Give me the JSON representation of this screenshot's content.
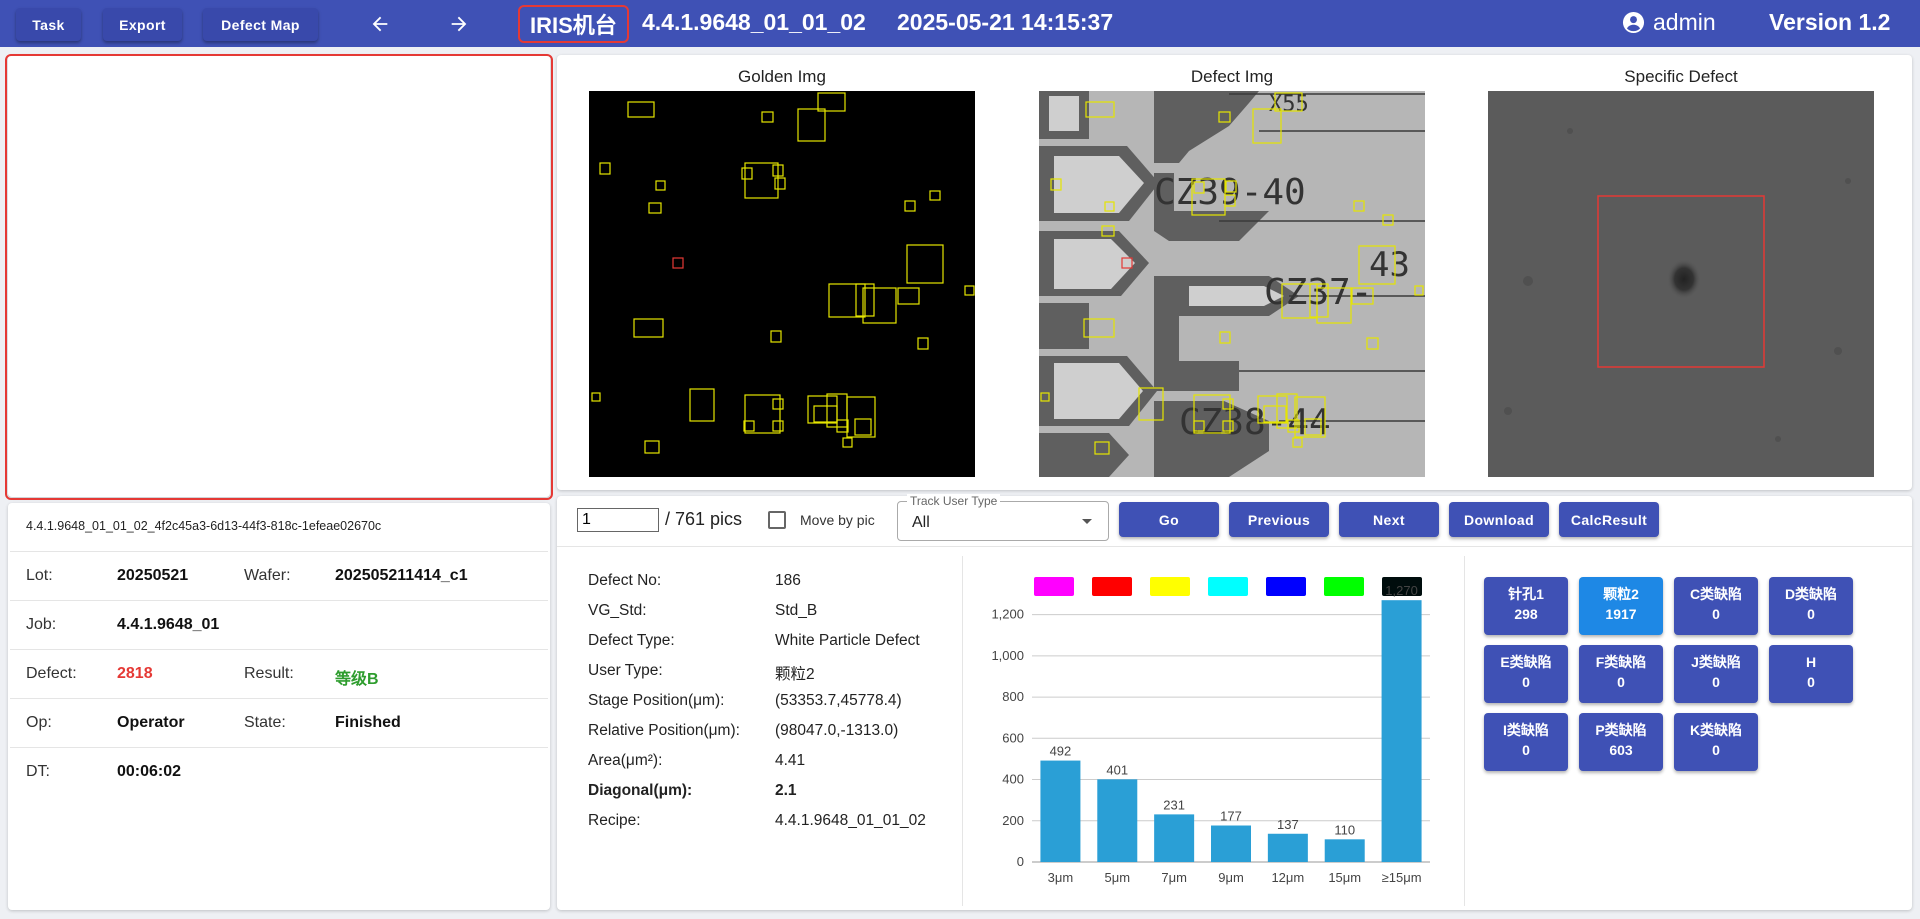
{
  "toolbar": {
    "task_label": "Task",
    "export_label": "Export",
    "defect_map_label": "Defect Map",
    "machine_label": "IRIS机台",
    "recipe_title": "4.4.1.9648_01_01_02",
    "datetime": "2025-05-21 14:15:37",
    "user_name": "admin",
    "version": "Version 1.2"
  },
  "images": {
    "golden_title": "Golden Img",
    "defect_title": "Defect Img",
    "specific_title": "Specific Defect",
    "defect_labels": {
      "row1": "CZ39-40",
      "row2": "CZ37-",
      "row3": "CZ38-44",
      "badge": "43",
      "top": "X55"
    }
  },
  "left_info": {
    "uuid": "4.4.1.9648_01_01_02_4f2c45a3-6d13-44f3-818c-1efeae02670c",
    "lot_label": "Lot:",
    "lot_value": "20250521",
    "wafer_label": "Wafer:",
    "wafer_value": "202505211414_c1",
    "job_label": "Job:",
    "job_value": "4.4.1.9648_01",
    "defect_label": "Defect:",
    "defect_value": "2818",
    "result_label": "Result:",
    "result_value": "等级B",
    "op_label": "Op:",
    "op_value": "Operator",
    "state_label": "State:",
    "state_value": "Finished",
    "dt_label": "DT:",
    "dt_value": "00:06:02"
  },
  "controls": {
    "page_value": "1",
    "page_total": "/ 761 pics",
    "move_by_pic_label": "Move by pic",
    "track_user_type_label": "Track User Type",
    "track_user_type_value": "All",
    "go_label": "Go",
    "previous_label": "Previous",
    "next_label": "Next",
    "download_label": "Download",
    "calc_result_label": "CalcResult"
  },
  "defect_detail": {
    "defect_no_label": "Defect No:",
    "defect_no_value": "186",
    "vg_std_label": "VG_Std:",
    "vg_std_value": "Std_B",
    "defect_type_label": "Defect Type:",
    "defect_type_value": "White Particle Defect",
    "user_type_label": "User Type:",
    "user_type_value": "颗粒2",
    "stage_pos_label": "Stage Position(μm):",
    "stage_pos_value": "(53353.7,45778.4)",
    "rel_pos_label": "Relative Position(μm):",
    "rel_pos_value": "(98047.0,-1313.0)",
    "area_label": "Area(μm²):",
    "area_value": "4.41",
    "diagonal_label": "Diagonal(μm):",
    "diagonal_value": "2.1",
    "recipe_label": "Recipe:",
    "recipe_value": "4.4.1.9648_01_01_02"
  },
  "legend_colors": [
    "#ff00ff",
    "#ff0000",
    "#ffff00",
    "#00ffff",
    "#0000ff",
    "#00ff00",
    "#000d0d"
  ],
  "chart_data": {
    "type": "bar",
    "categories": [
      "3μm",
      "5μm",
      "7μm",
      "9μm",
      "12μm",
      "15μm",
      "≥15μm"
    ],
    "values": [
      492,
      401,
      231,
      177,
      137,
      110,
      1270
    ],
    "ylim": [
      0,
      1300
    ],
    "yticks": [
      "0",
      "200",
      "400",
      "600",
      "800",
      "1,000",
      "1,200"
    ],
    "value_labels": [
      "492",
      "401",
      "231",
      "177",
      "137",
      "110",
      "1,270"
    ],
    "bar_color": "#2a9fd6",
    "grid": true
  },
  "categories_tiles": [
    {
      "name": "针孔1",
      "count": "298",
      "active": false
    },
    {
      "name": "颗粒2",
      "count": "1917",
      "active": true
    },
    {
      "name": "C类缺陷",
      "count": "0",
      "active": false
    },
    {
      "name": "D类缺陷",
      "count": "0",
      "active": false
    },
    {
      "name": "E类缺陷",
      "count": "0",
      "active": false
    },
    {
      "name": "F类缺陷",
      "count": "0",
      "active": false
    },
    {
      "name": "J类缺陷",
      "count": "0",
      "active": false
    },
    {
      "name": "H",
      "count": "0",
      "active": false
    },
    {
      "name": "I类缺陷",
      "count": "0",
      "active": false
    },
    {
      "name": "P类缺陷",
      "count": "603",
      "active": false
    },
    {
      "name": "K类缺陷",
      "count": "0",
      "active": false
    }
  ]
}
